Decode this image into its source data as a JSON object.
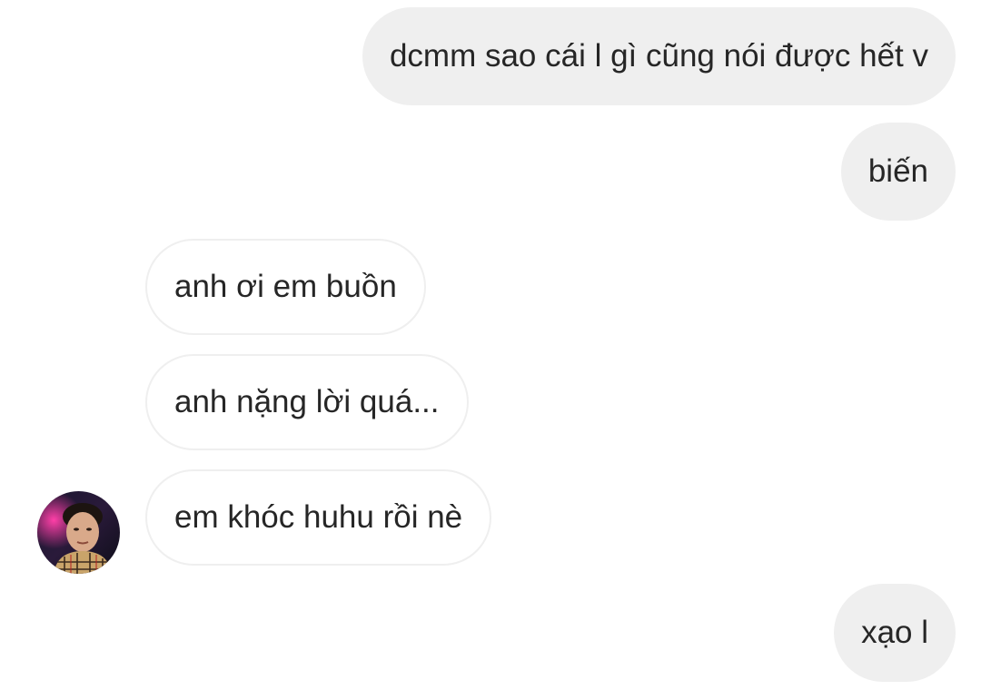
{
  "messages": [
    {
      "id": "msg-1",
      "direction": "sent",
      "text": "dcmm sao cái l gì cũng nói được hết v"
    },
    {
      "id": "msg-2",
      "direction": "sent",
      "text": "biến"
    },
    {
      "id": "msg-3",
      "direction": "received",
      "text": "anh ơi em buồn"
    },
    {
      "id": "msg-4",
      "direction": "received",
      "text": "anh nặng lời quá..."
    },
    {
      "id": "msg-5",
      "direction": "received",
      "text": "em khóc huhu rồi nè"
    },
    {
      "id": "msg-6",
      "direction": "sent",
      "text": "xạo l"
    }
  ],
  "colors": {
    "sent_bubble": "#efefef",
    "received_border": "#efefef",
    "text": "#262626",
    "background": "#ffffff"
  },
  "avatar": {
    "icon": "user-profile-photo"
  }
}
